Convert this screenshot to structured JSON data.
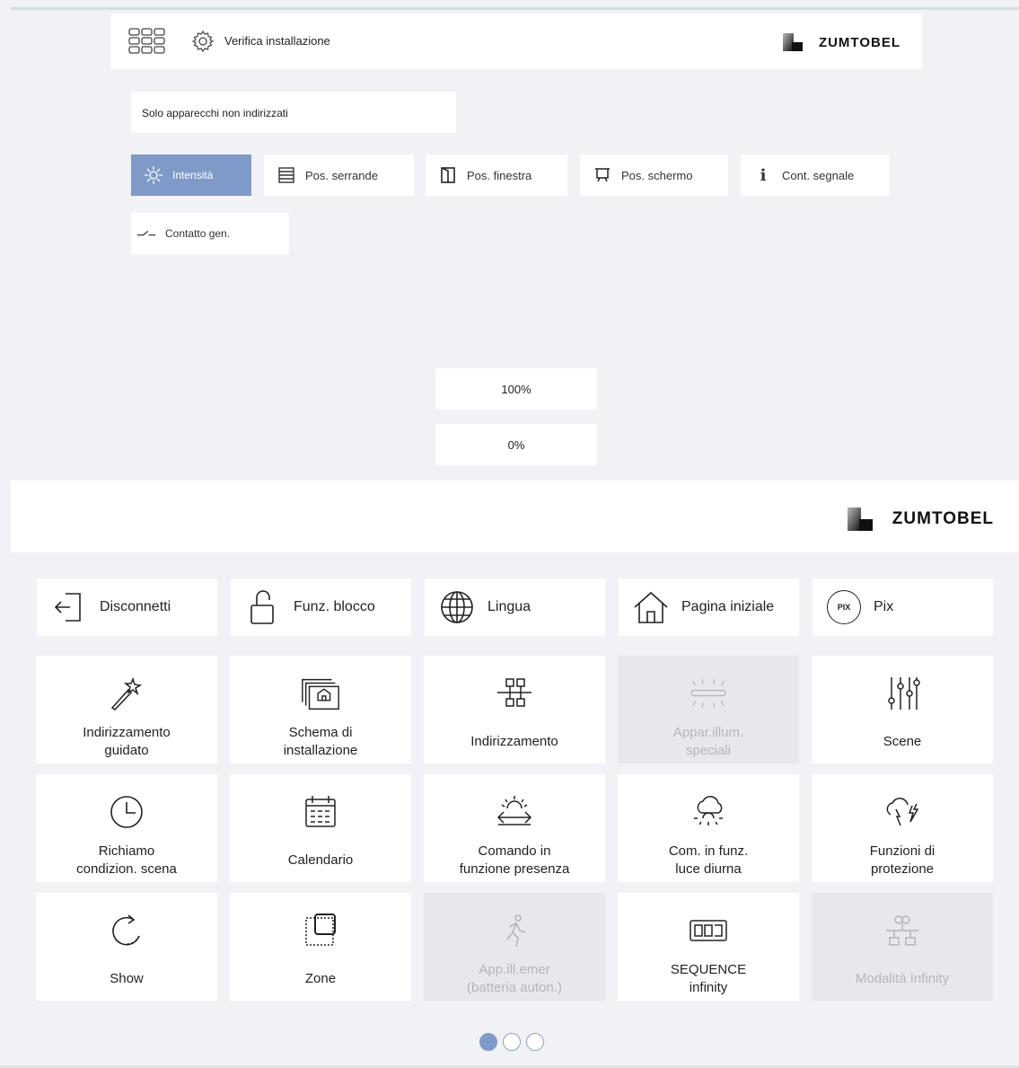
{
  "top_header": {
    "title": "Verifica installazione",
    "brand": "ZUMTOBEL"
  },
  "filter": {
    "label": "Solo apparecchi non indirizzati"
  },
  "chips": [
    {
      "label": "Intensità",
      "icon": "sun-icon",
      "active": true
    },
    {
      "label": "Pos. serrande",
      "icon": "blinds-icon"
    },
    {
      "label": "Pos. finestra",
      "icon": "window-icon"
    },
    {
      "label": "Pos. schermo",
      "icon": "screen-icon"
    },
    {
      "label": "Cont. segnale",
      "icon": "info-icon"
    },
    {
      "label": "Contatto gen.",
      "icon": "switch-contact-icon"
    }
  ],
  "values": {
    "max": "100%",
    "min": "0%"
  },
  "bottom_header": {
    "brand": "ZUMTOBEL"
  },
  "top_buttons": [
    {
      "label": "Disconnetti",
      "icon": "logout-icon"
    },
    {
      "label": "Funz. blocco",
      "icon": "unlock-icon"
    },
    {
      "label": "Lingua",
      "icon": "globe-icon"
    },
    {
      "label": "Pagina iniziale",
      "icon": "home-icon"
    },
    {
      "label": "Pix",
      "icon": "pix-icon",
      "icon_text": "PIX"
    }
  ],
  "tiles": [
    {
      "label": "Indirizzamento\nguidato",
      "icon": "magic-wand-icon",
      "disabled": false
    },
    {
      "label": "Schema di\ninstallazione",
      "icon": "floor-plan-icon",
      "disabled": false
    },
    {
      "label": "Indirizzamento",
      "icon": "network-icon",
      "disabled": false
    },
    {
      "label": "Appar.illum.\nspeciali",
      "icon": "special-luminaire-icon",
      "disabled": true
    },
    {
      "label": "Scene",
      "icon": "sliders-icon",
      "disabled": false
    },
    {
      "label": "Richiamo\ncondizion. scena",
      "icon": "clock-icon",
      "disabled": false
    },
    {
      "label": "Calendario",
      "icon": "calendar-icon",
      "disabled": false
    },
    {
      "label": "Comando in\nfunzione presenza",
      "icon": "presence-icon",
      "disabled": false
    },
    {
      "label": "Com. in funz.\nluce diurna",
      "icon": "daylight-icon",
      "disabled": false
    },
    {
      "label": "Funzioni di\nprotezione",
      "icon": "protection-icon",
      "disabled": false
    },
    {
      "label": "Show",
      "icon": "show-icon",
      "disabled": false
    },
    {
      "label": "Zone",
      "icon": "zone-icon",
      "disabled": false
    },
    {
      "label": "App.ill.emer\n(batteria auton.)",
      "icon": "emergency-icon",
      "disabled": true
    },
    {
      "label": "SEQUENCE\ninfinity",
      "icon": "sequence-icon",
      "disabled": false
    },
    {
      "label": "Modalità Infinity",
      "icon": "infinity-mode-icon",
      "disabled": true
    }
  ],
  "pagination": {
    "pages": 3,
    "current": 1
  },
  "colors": {
    "accent": "#7f9ac8",
    "background": "#f1f2f6",
    "tile": "#ffffff",
    "disabled_tile": "#e7e8ee"
  }
}
